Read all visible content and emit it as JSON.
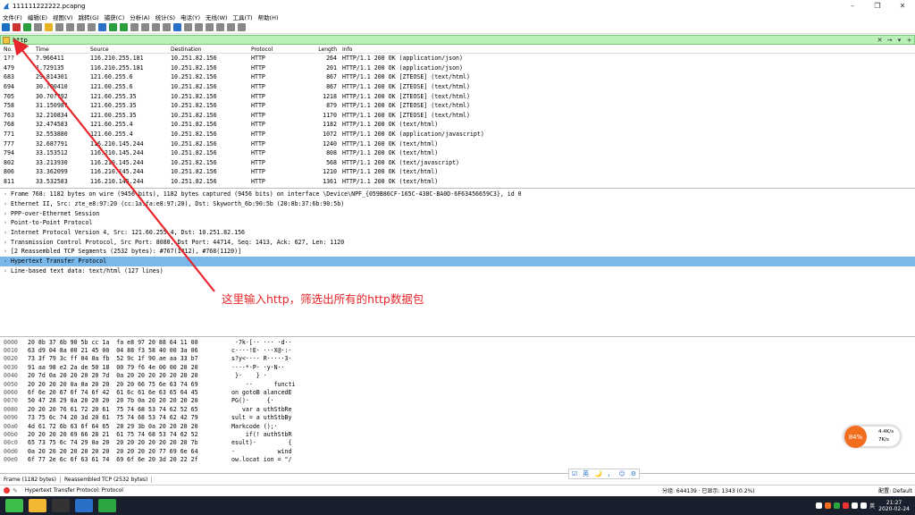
{
  "window": {
    "title": "111111222222.pcapng",
    "controls": [
      "–",
      "❐",
      "✕"
    ]
  },
  "menu": [
    "文件(F)",
    "编辑(E)",
    "视图(V)",
    "跳转(G)",
    "捕获(C)",
    "分析(A)",
    "统计(S)",
    "电话(Y)",
    "无线(W)",
    "工具(T)",
    "帮助(H)"
  ],
  "toolbar_colors": [
    "#1d6fc4",
    "#c33",
    "#2a9e3f",
    "#888",
    "#e6b422",
    "#888",
    "#888",
    "#888",
    "#888",
    "#2a6fc8",
    "#2a9e3f",
    "#2a9e3f",
    "#888",
    "#888",
    "#888",
    "#888",
    "#2a6fc8",
    "#888",
    "#888",
    "#888",
    "#888",
    "#888",
    "#888"
  ],
  "filter": {
    "value": "http",
    "clear": "✕",
    "apply": "→",
    "dropdown": "▾",
    "add": "+"
  },
  "packet_list": {
    "columns": [
      "No.",
      "Time",
      "Source",
      "Destination",
      "Protocol",
      "Length",
      "Info"
    ],
    "rows": [
      [
        "1??",
        "7.966411",
        "116.210.255.181",
        "10.251.82.156",
        "HTTP",
        "264",
        "HTTP/1.1 200 OK  (application/json)"
      ],
      [
        "479",
        "1.729135",
        "116.210.255.181",
        "10.251.82.156",
        "HTTP",
        "201",
        "HTTP/1.1 200 OK  (application/json)"
      ],
      [
        "683",
        "29.814301",
        "121.60.255.6",
        "10.251.82.156",
        "HTTP",
        "867",
        "HTTP/1.1 200 OK [ZTEOSE]  (text/html)"
      ],
      [
        "694",
        "30.?00410",
        "121.60.255.6",
        "10.251.82.156",
        "HTTP",
        "867",
        "HTTP/1.1 200 OK [ZTEOSE]  (text/html)"
      ],
      [
        "705",
        "30.70??92",
        "121.60.255.35",
        "10.251.82.156",
        "HTTP",
        "1218",
        "HTTP/1.1 200 OK [ZTEOSE]  (text/html)"
      ],
      [
        "758",
        "31.15098?",
        "121.60.255.35",
        "10.251.82.156",
        "HTTP",
        "879",
        "HTTP/1.1 200 OK [ZTEOSE]  (text/html)"
      ],
      [
        "763",
        "32.210834",
        "121.60.255.35",
        "10.251.82.156",
        "HTTP",
        "1170",
        "HTTP/1.1 200 OK [ZTEOSE]  (text/html)"
      ],
      [
        "768",
        "32.474583",
        "121.60.255.4",
        "10.251.82.156",
        "HTTP",
        "1182",
        "HTTP/1.1 200 OK  (text/html)"
      ],
      [
        "771",
        "32.553880",
        "121.60.255.4",
        "10.251.82.156",
        "HTTP",
        "1072",
        "HTTP/1.1 200 OK  (application/javascript)"
      ],
      [
        "777",
        "32.687791",
        "116.210.145.244",
        "10.251.82.156",
        "HTTP",
        "1240",
        "HTTP/1.1 200 OK  (text/html)"
      ],
      [
        "794",
        "33.153512",
        "116.210.145.244",
        "10.251.82.156",
        "HTTP",
        "808",
        "HTTP/1.1 200 OK  (text/html)"
      ],
      [
        "802",
        "33.213930",
        "116.210.145.244",
        "10.251.82.156",
        "HTTP",
        "568",
        "HTTP/1.1 200 OK  (text/javascript)"
      ],
      [
        "806",
        "33.362099",
        "116.210.145.244",
        "10.251.82.156",
        "HTTP",
        "1210",
        "HTTP/1.1 200 OK  (text/html)"
      ],
      [
        "811",
        "33.532583",
        "116.210.145.244",
        "10.251.82.156",
        "HTTP",
        "1361",
        "HTTP/1.1 200 OK  (text/html)"
      ]
    ]
  },
  "details": [
    {
      "text": "Frame 768: 1182 bytes on wire (9456 bits), 1182 bytes captured (9456 bits) on interface \\Device\\NPF_{059B86CF-165C-438C-BA0D-6F63456659C3}, id 0",
      "selected": false
    },
    {
      "text": "Ethernet II, Src: zte_e8:97:20 (cc:1a:fa:e8:97:20), Dst: Skyworth_6b:90:5b (20:8b:37:6b:90:5b)",
      "selected": false
    },
    {
      "text": "PPP-over-Ethernet Session",
      "selected": false
    },
    {
      "text": "Point-to-Point Protocol",
      "selected": false
    },
    {
      "text": "Internet Protocol Version 4, Src: 121.60.255.4, Dst: 10.251.82.156",
      "selected": false
    },
    {
      "text": "Transmission Control Protocol, Src Port: 8080, Dst Port: 44714, Seq: 1413, Ack: 627, Len: 1120",
      "selected": false
    },
    {
      "text": "[2 Reassembled TCP Segments (2532 bytes): #767(1412), #768(1120)]",
      "selected": false
    },
    {
      "text": "Hypertext Transfer Protocol",
      "selected": true
    },
    {
      "text": "Line-based text data: text/html (127 lines)",
      "selected": false
    }
  ],
  "annotation": "这里输入http，筛选出所有的http数据包",
  "bytes": [
    [
      "0000",
      "20 8b 37 6b 90 5b cc 1a  fa e8 97 20 88 64 11 00",
      " ·7k·[·· ··· ·d··"
    ],
    [
      "0010",
      "63 d9 04 8a 00 21 45 00  04 88 f3 58 40 00 3a 06",
      "c····!E· ···X@·:·"
    ],
    [
      "0020",
      "73 3f 79 3c ff 04 0a fb  52 9c 1f 90 ae aa 33 b7",
      "s?y<···· R·····3·"
    ],
    [
      "0030",
      "91 aa 98 e2 2a de 50 18  00 79 f6 4e 00 00 20 20",
      "····*·P· ·y·N··  "
    ],
    [
      "0040",
      "20 7d 0a 20 20 20 20 7d  0a 20 20 20 20 20 20 20",
      " }·    } ·       "
    ],
    [
      "0050",
      "20 20 20 20 0a 0a 20 20  20 20 66 75 6e 63 74 69",
      "    ··      functi"
    ],
    [
      "0060",
      "6f 6e 20 67 6f 74 6f 42  61 6c 61 6e 63 65 64 45",
      "on gotoB alancedE"
    ],
    [
      "0070",
      "50 47 28 29 0a 20 20 20  20 7b 0a 20 20 20 20 20",
      "PG()·     {·     "
    ],
    [
      "0080",
      "20 20 20 76 61 72 20 61  75 74 68 53 74 62 52 65",
      "   var a uthStbRe"
    ],
    [
      "0090",
      "73 75 6c 74 20 3d 20 61  75 74 68 53 74 62 42 79",
      "sult = a uthStbBy"
    ],
    [
      "00a0",
      "4d 61 72 6b 63 6f 64 65  28 29 3b 0a 20 20 20 20",
      "Markcode ();·    "
    ],
    [
      "00b0",
      "20 20 20 20 69 66 28 21  61 75 74 68 53 74 62 52",
      "    if(! authStbR"
    ],
    [
      "00c0",
      "65 73 75 6c 74 29 0a 20  20 20 20 20 20 20 20 7b",
      "esult)·         {"
    ],
    [
      "00d0",
      "0a 20 20 20 20 20 20 20  20 20 20 20 77 69 6e 64",
      "·            wind"
    ],
    [
      "00e0",
      "6f 77 2e 6c 6f 63 61 74  69 6f 6e 20 3d 20 22 2f",
      "ow.locat ion = \"/"
    ]
  ],
  "byte_tabs": [
    "Frame (1182 bytes)",
    "Reassembled TCP (2532 bytes)"
  ],
  "status": {
    "protocol": "Hypertext Transfer Protocol: Protocol",
    "packets": "分组: 644139 · 已显示: 1343 (0.2%)",
    "profile": "配置: Default"
  },
  "net_widget": {
    "percent": "84%",
    "up": "4.4K/s",
    "down": "7K/s"
  },
  "ime_toolbar": [
    "☑",
    "英",
    "🌙",
    "，",
    "☺",
    "⚙"
  ],
  "tray": {
    "lang": "英",
    "time": "21:27",
    "date": "2020-02-24"
  },
  "taskbar_colors": [
    "#3bbf4a",
    "#f2b632",
    "#333",
    "#2a6fc8",
    "#2ca640"
  ]
}
